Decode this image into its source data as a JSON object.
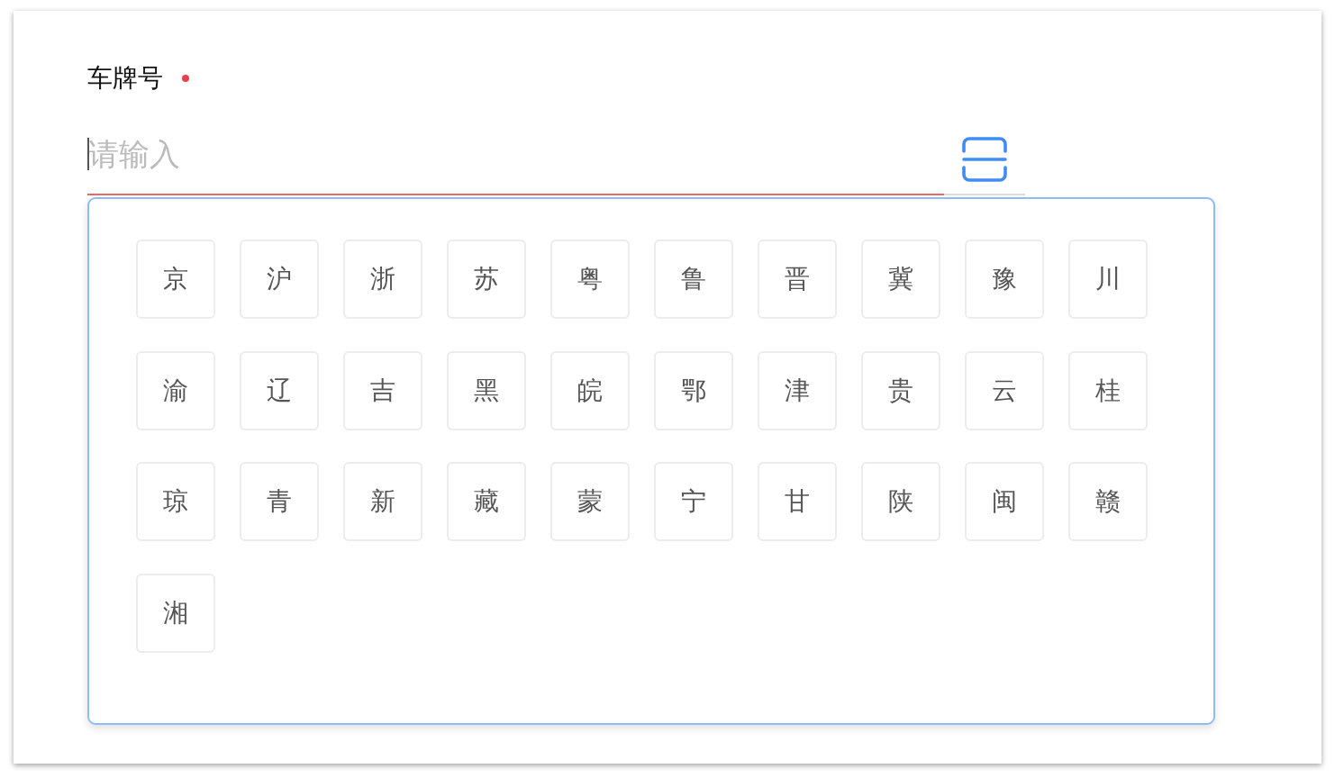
{
  "form_field": {
    "label": "车牌号",
    "required": true
  },
  "plate_input": {
    "placeholder": "请输入",
    "focused": true,
    "invalid": true
  },
  "province_keyboard": {
    "keys": [
      "京",
      "沪",
      "浙",
      "苏",
      "粤",
      "鲁",
      "晋",
      "冀",
      "豫",
      "川",
      "渝",
      "辽",
      "吉",
      "黑",
      "皖",
      "鄂",
      "津",
      "贵",
      "云",
      "桂",
      "琼",
      "青",
      "新",
      "藏",
      "蒙",
      "宁",
      "甘",
      "陕",
      "闽",
      "赣",
      "湘"
    ]
  }
}
